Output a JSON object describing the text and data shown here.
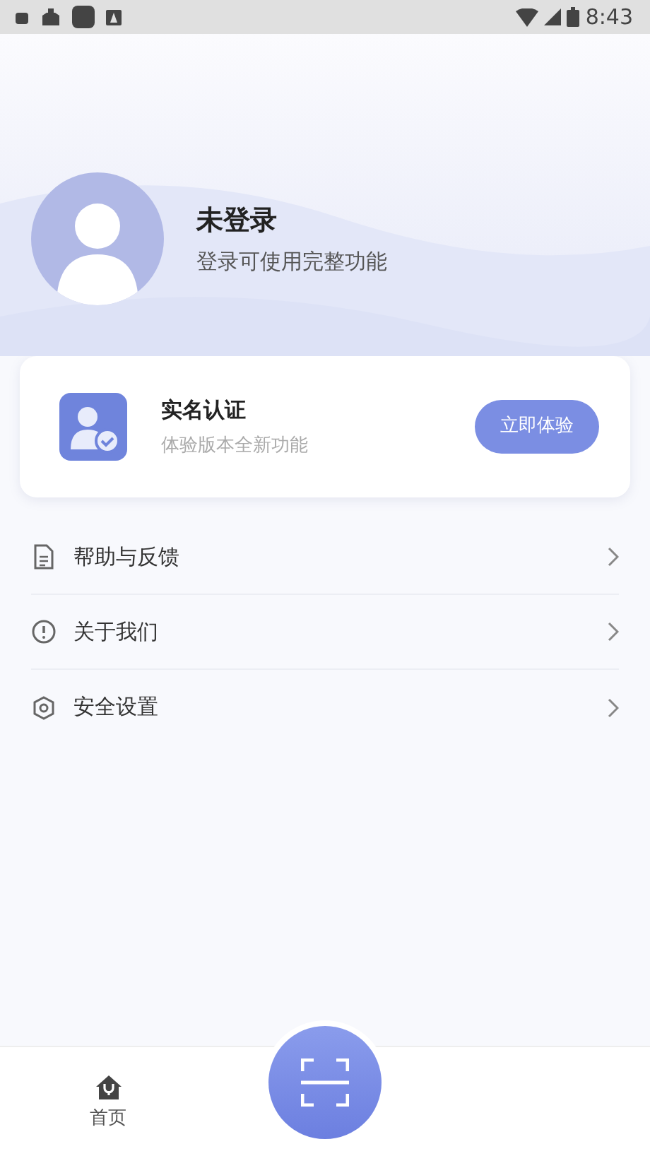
{
  "status_bar": {
    "time": "8:43"
  },
  "profile": {
    "name": "未登录",
    "subtitle": "登录可使用完整功能"
  },
  "verify_card": {
    "title": "实名认证",
    "subtitle": "体验版本全新功能",
    "button": "立即体验"
  },
  "menu": [
    {
      "kind": "document",
      "label": "帮助与反馈"
    },
    {
      "kind": "info",
      "label": "关于我们"
    },
    {
      "kind": "shield",
      "label": "安全设置"
    }
  ],
  "bottom_nav": {
    "tabs": [
      {
        "kind": "home",
        "label": "首页"
      }
    ]
  }
}
